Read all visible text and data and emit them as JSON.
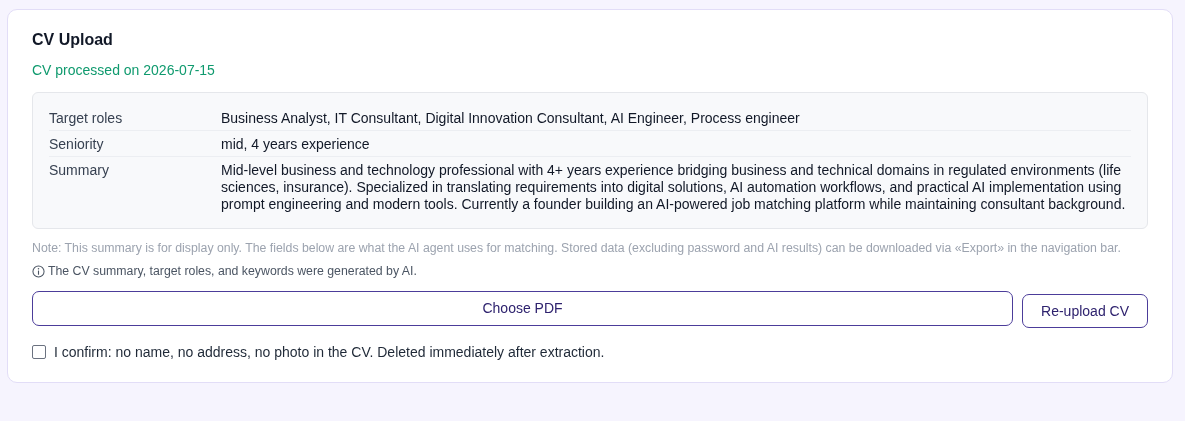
{
  "card": {
    "title": "CV Upload",
    "status": "CV processed on 2026-07-15",
    "details": [
      {
        "label": "Target roles",
        "value": "Business Analyst, IT Consultant, Digital Innovation Consultant, AI Engineer, Process engineer"
      },
      {
        "label": "Seniority",
        "value": "mid, 4 years experience"
      },
      {
        "label": "Summary",
        "value": "Mid-level business and technology professional with 4+ years experience bridging business and technical domains in regulated environments (life sciences, insurance). Specialized in translating requirements into digital solutions, AI automation workflows, and practical AI implementation using prompt engineering and modern tools. Currently a founder building an AI-powered job matching platform while maintaining consultant background."
      }
    ],
    "note": "Note: This summary is for display only. The fields below are what the AI agent uses for matching. Stored data (excluding password and AI results) can be downloaded via «Export» in the navigation bar.",
    "ai_notice": "The CV summary, target roles, and keywords were generated by AI.",
    "choose_button": "Choose PDF",
    "reupload_button": "Re-upload CV",
    "confirm": {
      "label": "I confirm: no name, no address, no photo in the CV. Deleted immediately after extraction.",
      "checked": false
    }
  }
}
